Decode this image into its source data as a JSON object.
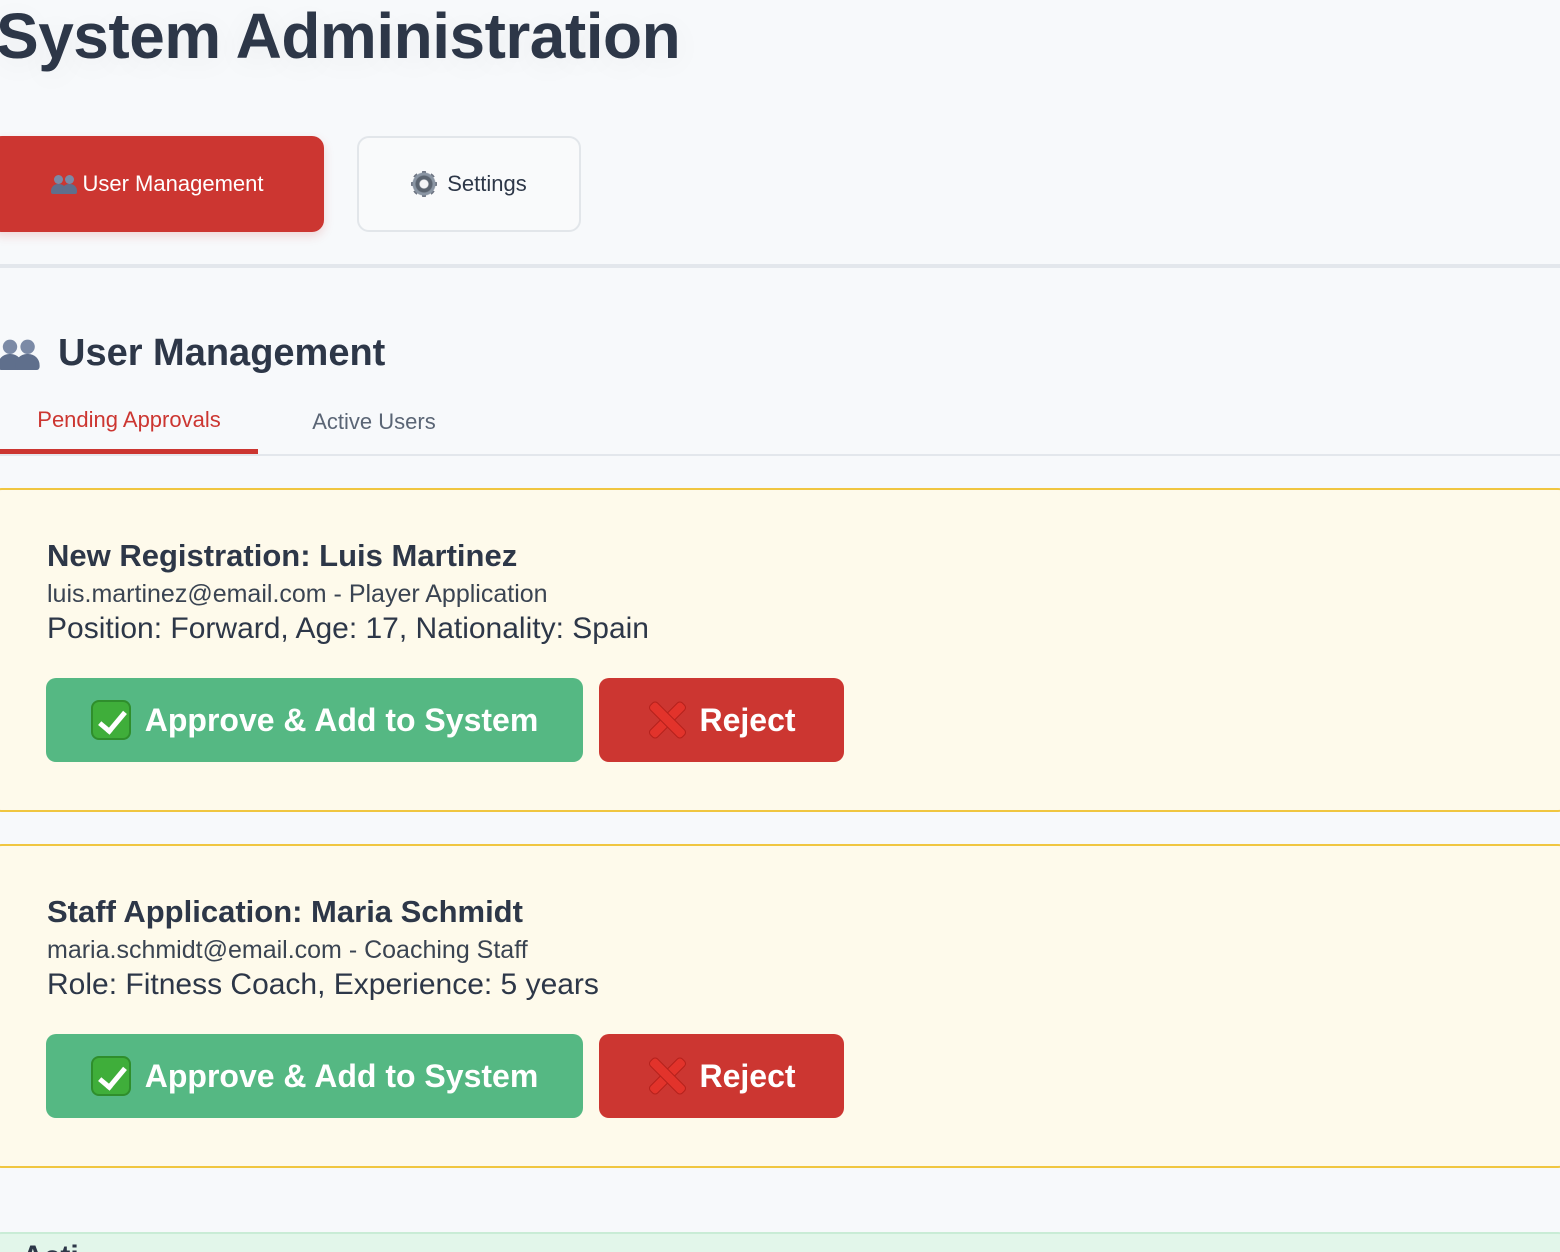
{
  "page": {
    "title": "System Administration"
  },
  "nav": {
    "user_management_label": "User Management",
    "user_management_icon": "people-icon",
    "settings_label": "Settings",
    "settings_icon": "gear-icon",
    "active": "User Management"
  },
  "section": {
    "title": "User Management",
    "icon": "people-icon"
  },
  "tabs": [
    {
      "label": "Pending Approvals",
      "active": true
    },
    {
      "label": "Active Users",
      "active": false
    }
  ],
  "pending": [
    {
      "title": "New Registration: Luis Martinez",
      "subtitle": "luis.martinez@email.com - Player Application",
      "detail": "Position: Forward, Age: 17, Nationality: Spain",
      "approve_label": "Approve & Add to System",
      "reject_label": "Reject"
    },
    {
      "title": "Staff Application: Maria Schmidt",
      "subtitle": "maria.schmidt@email.com - Coaching Staff",
      "detail": "Role: Fitness Coach, Experience: 5 years",
      "approve_label": "Approve & Add to System",
      "reject_label": "Reject"
    }
  ],
  "activity": {
    "label": "Acti"
  },
  "colors": {
    "accent": "#cc3631",
    "approve": "#55b883",
    "card_bg": "#fefaeb",
    "card_border": "#f0c640",
    "text": "#2d3748"
  }
}
